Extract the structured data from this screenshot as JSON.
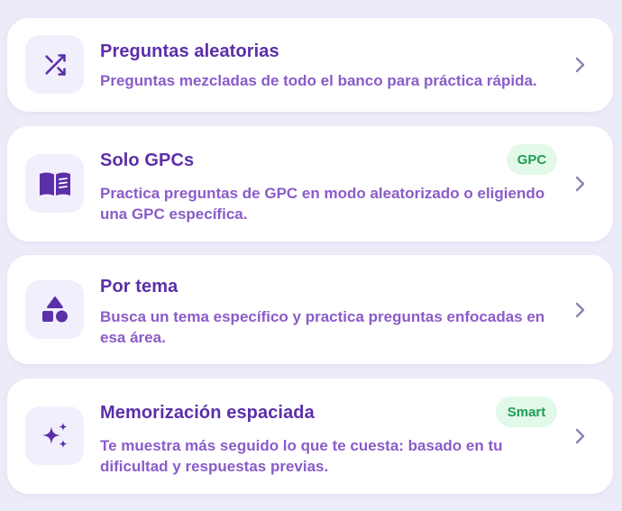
{
  "colors": {
    "background": "#ecebf8",
    "card": "#ffffff",
    "icon_tile": "#f2effd",
    "accent": "#5b2fa8",
    "description": "#8a5cc9",
    "badge_bg": "#e2f8e8",
    "badge_text": "#1f9d55",
    "chevron": "#8e80b3"
  },
  "options": [
    {
      "icon": "shuffle-icon",
      "title": "Preguntas aleatorias",
      "description": "Preguntas mezcladas de todo el banco para práctica rápida.",
      "badge": null
    },
    {
      "icon": "book-icon",
      "title": "Solo GPCs",
      "description": "Practica preguntas de GPC en modo aleatorizado o eligiendo una GPC específica.",
      "badge": "GPC"
    },
    {
      "icon": "shapes-icon",
      "title": "Por tema",
      "description": "Busca un tema específico y practica preguntas enfocadas en esa área.",
      "badge": null
    },
    {
      "icon": "sparkles-icon",
      "title": "Memorización espaciada",
      "description": "Te muestra más seguido lo que te cuesta: basado en tu dificultad y respuestas previas.",
      "badge": "Smart"
    }
  ]
}
